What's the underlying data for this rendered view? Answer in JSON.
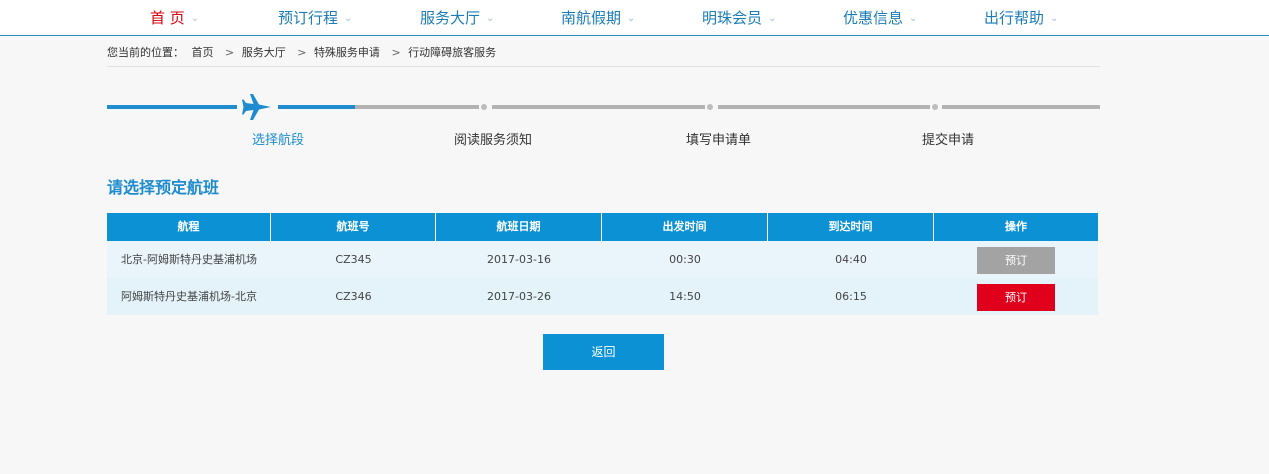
{
  "nav": {
    "items": [
      {
        "label": "首 页",
        "active": true
      },
      {
        "label": "预订行程",
        "active": false
      },
      {
        "label": "服务大厅",
        "active": false
      },
      {
        "label": "南航假期",
        "active": false
      },
      {
        "label": "明珠会员",
        "active": false
      },
      {
        "label": "优惠信息",
        "active": false
      },
      {
        "label": "出行帮助",
        "active": false
      }
    ],
    "chevron_icon": "chevron-down-icon"
  },
  "breadcrumb": {
    "prefix": "您当前的位置：",
    "items": [
      "首页",
      "服务大厅",
      "特殊服务申请",
      "行动障碍旅客服务"
    ],
    "separator": ">"
  },
  "steps": {
    "items": [
      {
        "label": "选择航段",
        "active": true
      },
      {
        "label": "阅读服务须知",
        "active": false
      },
      {
        "label": "填写申请单",
        "active": false
      },
      {
        "label": "提交申请",
        "active": false
      }
    ],
    "current_icon": "airplane-icon"
  },
  "section_title": "请选择预定航班",
  "table": {
    "headers": [
      "航程",
      "航班号",
      "航班日期",
      "出发时间",
      "到达时间",
      "操作"
    ],
    "rows": [
      {
        "route": "北京-阿姆斯特丹史基浦机场",
        "flight": "CZ345",
        "date": "2017-03-16",
        "depart": "00:30",
        "arrive": "04:40",
        "action": "预订",
        "action_state": "disabled"
      },
      {
        "route": "阿姆斯特丹史基浦机场-北京",
        "flight": "CZ346",
        "date": "2017-03-26",
        "depart": "14:50",
        "arrive": "06:15",
        "action": "预订",
        "action_state": "enabled"
      }
    ]
  },
  "back_button": "返回",
  "colors": {
    "brand_blue": "#0d91d5",
    "active_red": "#d8000f",
    "book_red": "#e0001b",
    "book_disabled": "#a3a3a3"
  }
}
